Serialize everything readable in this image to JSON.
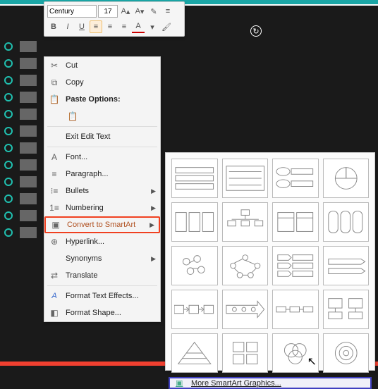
{
  "toolbar": {
    "font_name": "Century",
    "font_size": "17",
    "grow_font": "A▴",
    "shrink_font": "A▾",
    "format_painter": "✎",
    "bold": "B",
    "italic": "I",
    "underline": "U",
    "font_color_letter": "A"
  },
  "context_menu": {
    "cut": "Cut",
    "copy": "Copy",
    "paste_options": "Paste Options:",
    "exit_edit": "Exit Edit Text",
    "font": "Font...",
    "paragraph": "Paragraph...",
    "bullets": "Bullets",
    "numbering": "Numbering",
    "convert_smartart": "Convert to SmartArt",
    "hyperlink": "Hyperlink...",
    "synonyms": "Synonyms",
    "translate": "Translate",
    "text_effects": "Format Text Effects...",
    "format_shape": "Format Shape..."
  },
  "smartart": {
    "more": "More SmartArt Graphics..."
  }
}
